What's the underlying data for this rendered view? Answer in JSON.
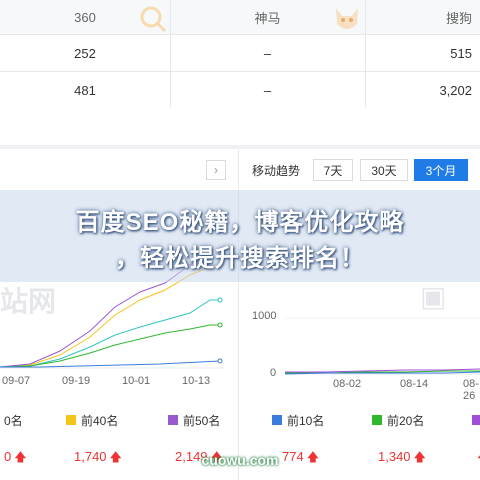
{
  "table": {
    "headers": [
      "360",
      "神马",
      "搜狗"
    ],
    "rows": [
      [
        "252",
        "–",
        "515"
      ],
      [
        "481",
        "–",
        "3,202"
      ]
    ]
  },
  "right_panel": {
    "title": "移动趋势",
    "tabs": [
      "7天",
      "30天",
      "3个月"
    ],
    "active_tab": "3个月",
    "y_ticks": [
      "1000",
      "0"
    ],
    "x_ticks": [
      "08-02",
      "08-14",
      "08-26"
    ]
  },
  "left_panel": {
    "x_ticks": [
      "09-07",
      "09-19",
      "10-01",
      "10-13"
    ]
  },
  "legend_left": [
    {
      "label": "0名",
      "color": "#2f9ee8"
    },
    {
      "label": "前40名",
      "color": "#f5c518"
    },
    {
      "label": "前50名",
      "color": "#9b59d0"
    }
  ],
  "legend_right": [
    {
      "label": "前10名",
      "color": "#3b7ddd"
    },
    {
      "label": "前20名",
      "color": "#2eb82e"
    },
    {
      "label": "",
      "color": "#a24dd8"
    }
  ],
  "values_left": [
    "0",
    "1,740",
    "2,149"
  ],
  "values_right": [
    "774",
    "1,340",
    ""
  ],
  "banner": {
    "line1": "百度SEO秘籍，博客优化攻略",
    "line2": "，轻松提升搜索排名！"
  },
  "watermark": "cuowu.com",
  "faint_logo": "站网"
}
